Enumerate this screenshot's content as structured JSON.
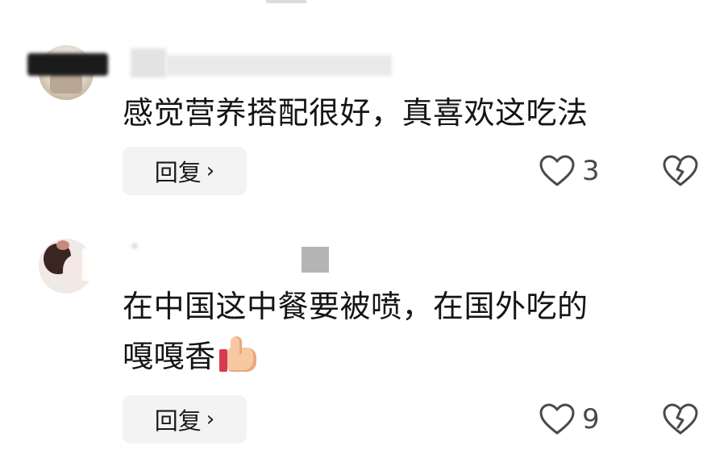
{
  "comments": [
    {
      "text": "感觉营养搭配很好，真喜欢这吃法",
      "reply_label": "回复",
      "reply_chevron": "›",
      "like_icon": "heart-outline-icon",
      "like_count": "3",
      "dislike_icon": "broken-heart-icon"
    },
    {
      "text": "在中国这中餐要被喷，在国外吃的",
      "text_line2": "嘎嘎香",
      "emoji": "thumbs-up-emoji",
      "reply_label": "回复",
      "reply_chevron": "›",
      "like_icon": "heart-outline-icon",
      "like_count": "9",
      "dislike_icon": "broken-heart-icon"
    }
  ],
  "colors": {
    "background": "#ffffff",
    "text": "#141414",
    "reply_bg": "#f3f3f3",
    "icon_gray": "#4a4a4a"
  }
}
